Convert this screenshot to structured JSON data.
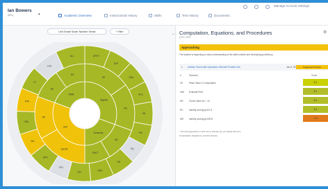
{
  "header": {
    "student_name": "Ian Bowers",
    "student_sub": "(001)",
    "tabs": [
      {
        "label": "Academic Overview",
        "active": true
      },
      {
        "label": "Instructional History",
        "active": false
      },
      {
        "label": "Skills",
        "active": false
      },
      {
        "label": "Test History",
        "active": false
      },
      {
        "label": "Documents",
        "active": false
      }
    ],
    "account_label": "Manage Account Settings"
  },
  "left_pane": {
    "selector_label": "Unit Grade Scale: Number Sense",
    "filter_label": "+ Filter"
  },
  "sunburst": {
    "center_label": "",
    "ring1": [
      {
        "label": "Algebra",
        "color": "#b2be28"
      },
      {
        "label": "Geometry",
        "color": "#b2be28"
      },
      {
        "label": "CEP",
        "color": "#f2c410"
      },
      {
        "label": "RMM",
        "color": "#b2be28"
      }
    ],
    "ring2_labels": [
      "EE",
      "NS",
      "HA",
      "ORCT",
      "GEOM",
      "RP",
      "EE",
      "NS"
    ],
    "outer_labels": [
      "ORTH",
      "EXP",
      "GRA",
      "ALG",
      "SN",
      "PM",
      "EQ",
      "RA",
      "GRA",
      "DT1",
      "NT1",
      "OPS",
      "MA",
      "ORA",
      "DTA",
      "CT",
      "PTF",
      "ALL"
    ]
  },
  "detail": {
    "title": "Computation, Equations, and Procedures",
    "subtitle": "6.PC.CEP",
    "approach_label": "Approaching",
    "description": "The student is beginning to show understanding of the skills needed and developing proficiency.",
    "suggestion": {
      "num": "1",
      "link": "Activity: Fluent with Operations Selected Problem Set",
      "date": "Jan 8, 2021",
      "button": "Suggested Practice"
    },
    "columns": {
      "code": "#",
      "description": "Standard",
      "score": "Score"
    },
    "rows": [
      {
        "code": "CE",
        "description": "Place Value & Computation",
        "score": "8.1",
        "color": "#c9d100"
      },
      {
        "code": "VaD",
        "description": "Evaluate RUS",
        "score": "8.1",
        "color": "#b2be28"
      },
      {
        "code": "MV",
        "description": "Check Value for < 10",
        "score": "8.2",
        "color": "#b2be28"
      },
      {
        "code": "RC",
        "description": "Identify and Apply EX A",
        "score": "8.4",
        "color": "#b2be28"
      },
      {
        "code": "MR",
        "description": "Identify and Apply MR B",
        "score": "7.6",
        "color": "#e07a1a"
      }
    ],
    "note1": "* Not all progressions in this unit or domain are yet taught this term",
    "note2": "Computation, Equations, and Procedures"
  }
}
